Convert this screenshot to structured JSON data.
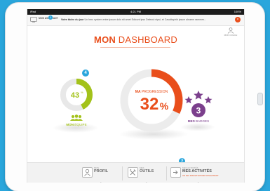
{
  "statusbar": {
    "device": "iPad",
    "time": "4:21 PM",
    "battery": "100%"
  },
  "notification": {
    "logo_text": "MON ASSISTANT",
    "badge": "1",
    "title": "Votre tâche du jour",
    "text": "Un herc system entre ipsum dolo sit amet Edicunt ipso Delecut nipsi, et Cavaltapirib ipsum aleaem rammen...",
    "close": "×"
  },
  "coach": {
    "label": "MON COACH"
  },
  "page": {
    "title_bold": "MON",
    "title_light": " DASHBOARD"
  },
  "team": {
    "value": "43",
    "unit": "%",
    "label_bold": "MON",
    "label_thin": " ÉQUIPE",
    "bubble": "4",
    "level": 0.43,
    "color": "#a3c21a"
  },
  "progression": {
    "label_bold": "MA",
    "label_thin": " PROGRESSION",
    "value": "32",
    "unit": "%",
    "level": 0.32,
    "color": "#e94e1b"
  },
  "badges": {
    "count": "3",
    "label_bold": "MES",
    "label_thin": " BADGES",
    "color": "#7b3f8c"
  },
  "footer": {
    "bubble": "3",
    "tiles": [
      {
        "small": "MON",
        "big": "PROFIL",
        "sub": ""
      },
      {
        "small": "MES",
        "big": "OUTILS",
        "sub": ""
      },
      {
        "small": "MES ACTIVITÉS",
        "big": "MES ACTIVITÉS",
        "sub": "UN JEU INSOLITE POUR VOS EXTRAIT"
      }
    ]
  }
}
